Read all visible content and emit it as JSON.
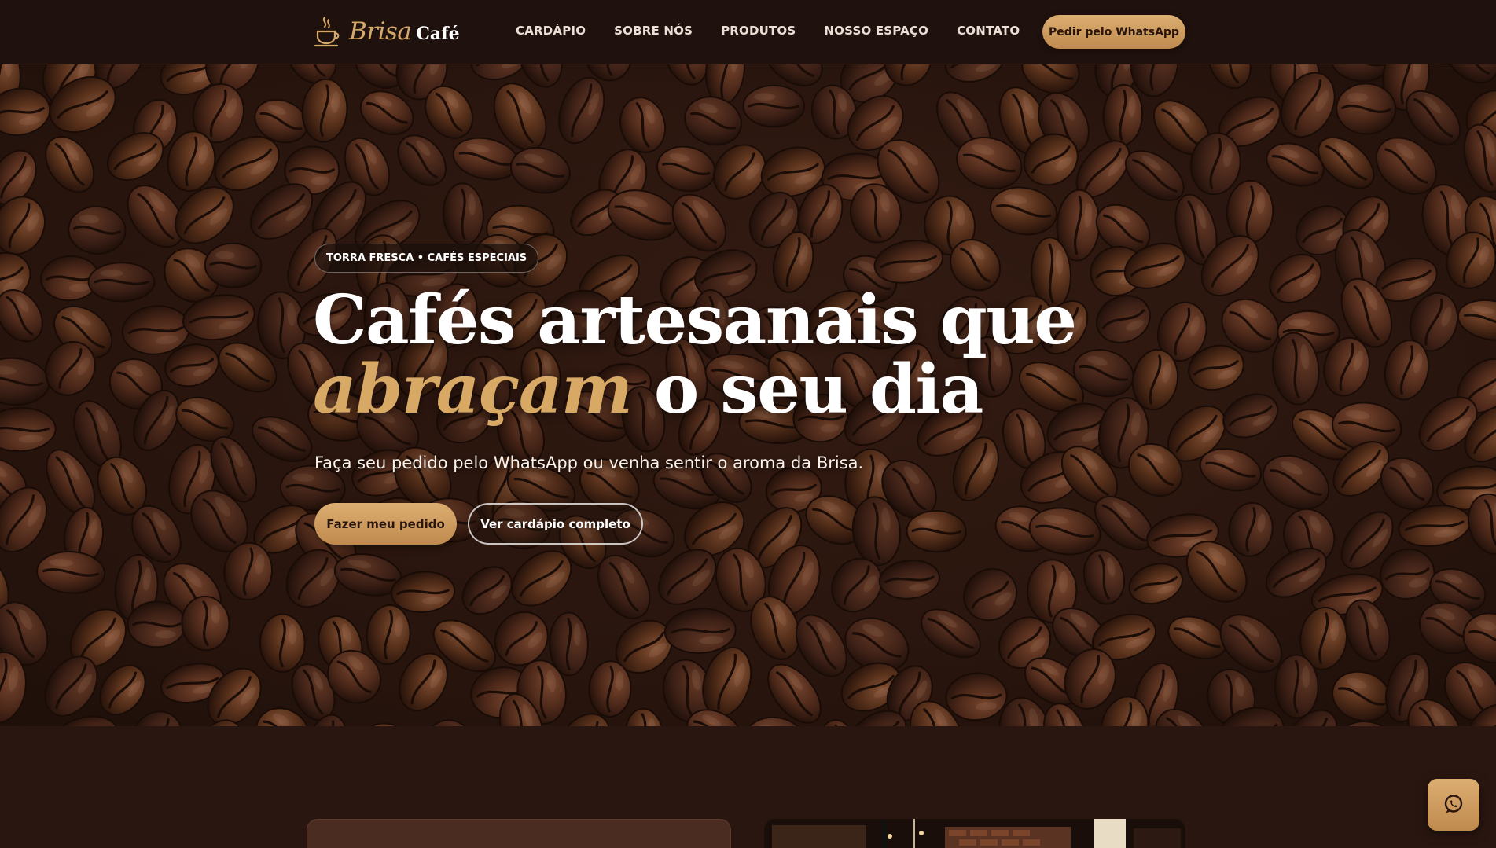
{
  "brand": {
    "name_script": "Brisa",
    "name_bold": "Café",
    "logo_icon": "coffee-cup-icon"
  },
  "nav": {
    "items": [
      {
        "label": "CARDÁPIO"
      },
      {
        "label": "SOBRE NÓS"
      },
      {
        "label": "PRODUTOS"
      },
      {
        "label": "NOSSO ESPAÇO"
      },
      {
        "label": "CONTATO"
      }
    ],
    "cta_label": "Pedir pelo WhatsApp"
  },
  "hero": {
    "badge": "TORRA FRESCA • CAFÉS ESPECIAIS",
    "headline_line1": "Cafés artesanais que",
    "headline_accent": "abraçam",
    "headline_rest": " o seu dia",
    "subtitle": "Faça seu pedido pelo WhatsApp ou venha sentir o aroma da Brisa.",
    "primary_button": "Fazer meu pedido",
    "secondary_button": "Ver cardápio completo",
    "background": "coffee-beans-photo"
  },
  "floating": {
    "icon": "whatsapp-icon"
  },
  "colors": {
    "accent": "#d8a865",
    "header_bg": "#1f110d",
    "section_bg": "#2a1610"
  }
}
